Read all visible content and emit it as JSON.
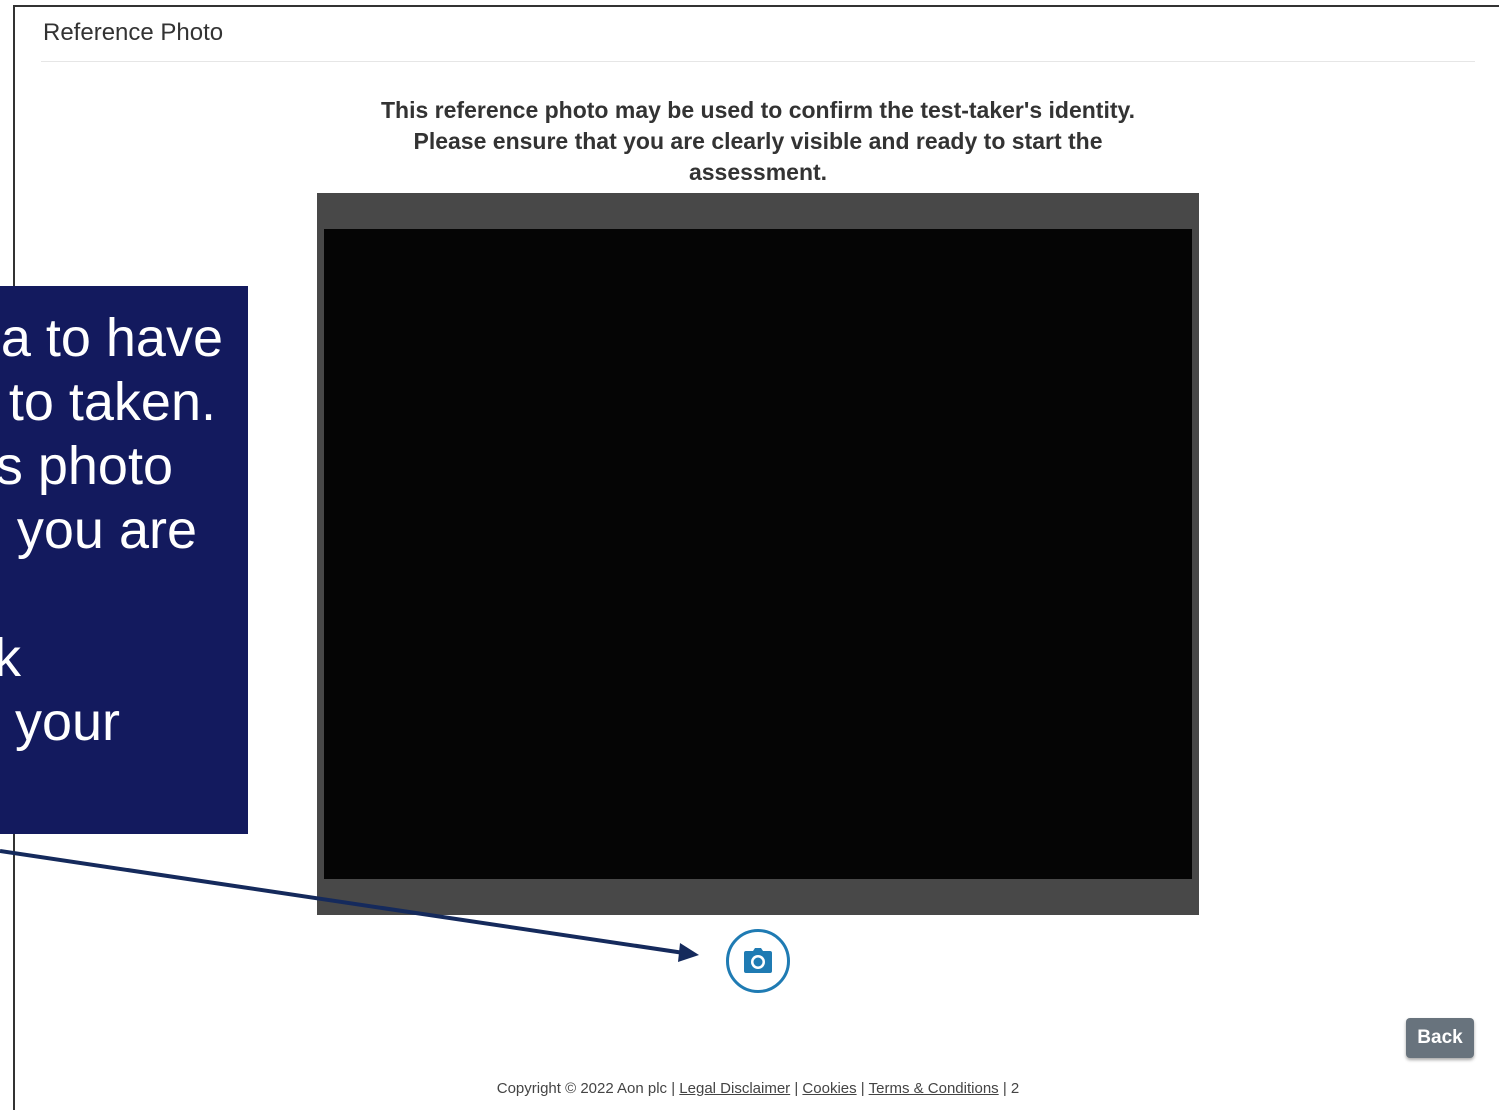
{
  "header": {
    "title": "Reference Photo"
  },
  "instructions": {
    "line1": "This reference photo may be used to confirm the test-taker's identity.",
    "line2": "Please ensure that you are clearly visible and ready to start the",
    "line3": "assessment."
  },
  "camera": {
    "capture_icon": "camera-icon",
    "accent_color": "#1f7bb3"
  },
  "buttons": {
    "back_label": "Back"
  },
  "footer": {
    "copyright": "Copyright © 2022 Aon plc |",
    "links": [
      "Legal Disclaimer",
      "Cookies",
      "Terms & Conditions"
    ],
    "separator": "|",
    "trailing": "2"
  },
  "callout": {
    "lines": [
      "a to have",
      "to taken.",
      "s photo",
      "you are",
      "k",
      "your"
    ],
    "background": "#131a5e"
  }
}
